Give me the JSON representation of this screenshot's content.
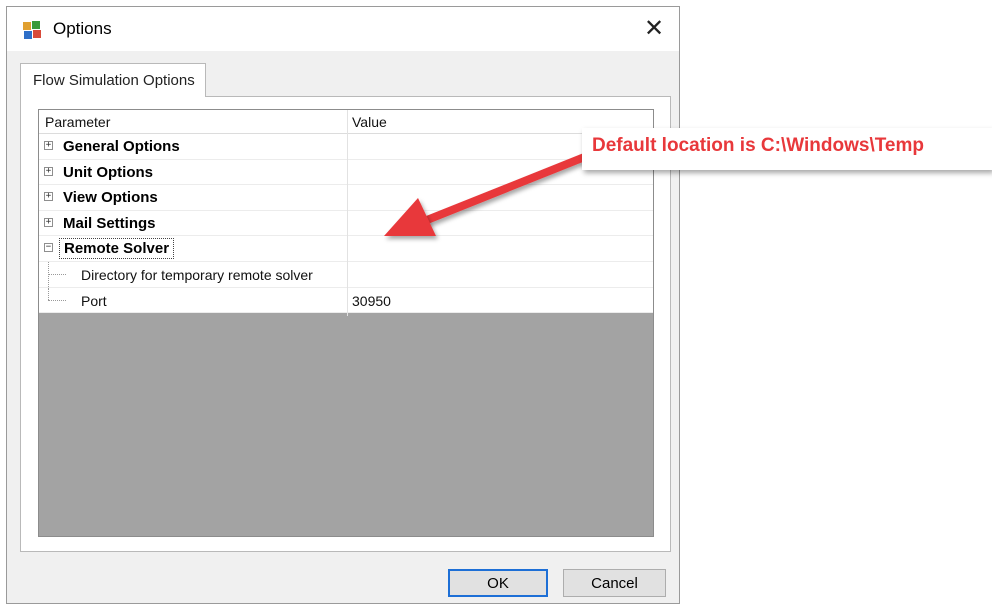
{
  "window": {
    "title": "Options",
    "close_glyph": "✕",
    "icon": "app-icon"
  },
  "tabs": [
    {
      "label": "Flow Simulation Options",
      "active": true
    }
  ],
  "grid": {
    "columns": {
      "parameter": "Parameter",
      "value": "Value"
    },
    "groups": [
      {
        "label": "General Options",
        "expanded": false
      },
      {
        "label": "Unit Options",
        "expanded": false
      },
      {
        "label": "View Options",
        "expanded": false
      },
      {
        "label": "Mail Settings",
        "expanded": false
      },
      {
        "label": "Remote Solver",
        "expanded": true,
        "selected": true
      }
    ],
    "children": [
      {
        "label": "Directory for temporary remote solver",
        "value": ""
      },
      {
        "label": "Port",
        "value": "30950"
      }
    ],
    "expander_collapsed": "+",
    "expander_expanded": "−"
  },
  "buttons": {
    "ok": "OK",
    "cancel": "Cancel"
  },
  "annotation": {
    "text": "Default location is C:\\Windows\\Temp",
    "color": "#e8383b"
  }
}
